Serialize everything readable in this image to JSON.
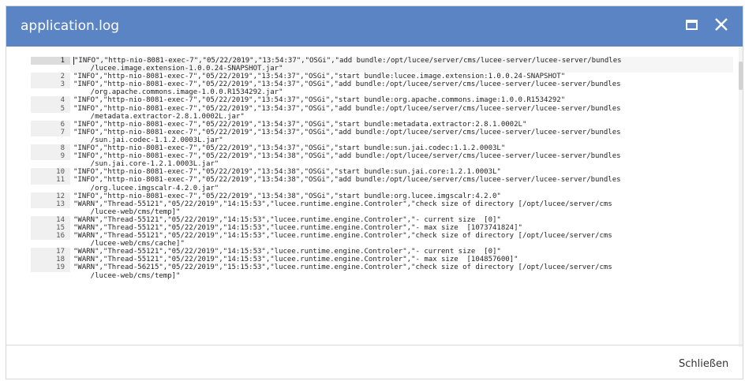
{
  "dialog": {
    "title": "application.log",
    "maximize_icon": "maximize-icon",
    "close_icon": "close-icon",
    "close_button_label": "Schließen",
    "header_color": "#5b84c4"
  },
  "log": {
    "lines": [
      {
        "num": "1",
        "text": "\"INFO\",\"http-nio-8081-exec-7\",\"05/22/2019\",\"13:54:37\",\"OSGi\",\"add bundle:/opt/lucee/server/cms/lucee-server/lucee-server/bundles\n    /lucee.image.extension-1.0.0.24-SNAPSHOT.jar\"",
        "active": true
      },
      {
        "num": "2",
        "text": "\"INFO\",\"http-nio-8081-exec-7\",\"05/22/2019\",\"13:54:37\",\"OSGi\",\"start bundle:lucee.image.extension:1.0.0.24-SNAPSHOT\""
      },
      {
        "num": "3",
        "text": "\"INFO\",\"http-nio-8081-exec-7\",\"05/22/2019\",\"13:54:37\",\"OSGi\",\"add bundle:/opt/lucee/server/cms/lucee-server/lucee-server/bundles\n    /org.apache.commons.image-1.0.0.R1534292.jar\""
      },
      {
        "num": "4",
        "text": "\"INFO\",\"http-nio-8081-exec-7\",\"05/22/2019\",\"13:54:37\",\"OSGi\",\"start bundle:org.apache.commons.image:1.0.0.R1534292\""
      },
      {
        "num": "5",
        "text": "\"INFO\",\"http-nio-8081-exec-7\",\"05/22/2019\",\"13:54:37\",\"OSGi\",\"add bundle:/opt/lucee/server/cms/lucee-server/lucee-server/bundles\n    /metadata.extractor-2.8.1.0002L.jar\""
      },
      {
        "num": "6",
        "text": "\"INFO\",\"http-nio-8081-exec-7\",\"05/22/2019\",\"13:54:37\",\"OSGi\",\"start bundle:metadata.extractor:2.8.1.0002L\""
      },
      {
        "num": "7",
        "text": "\"INFO\",\"http-nio-8081-exec-7\",\"05/22/2019\",\"13:54:37\",\"OSGi\",\"add bundle:/opt/lucee/server/cms/lucee-server/lucee-server/bundles\n    /sun.jai.codec-1.1.2.0003L.jar\""
      },
      {
        "num": "8",
        "text": "\"INFO\",\"http-nio-8081-exec-7\",\"05/22/2019\",\"13:54:37\",\"OSGi\",\"start bundle:sun.jai.codec:1.1.2.0003L\""
      },
      {
        "num": "9",
        "text": "\"INFO\",\"http-nio-8081-exec-7\",\"05/22/2019\",\"13:54:38\",\"OSGi\",\"add bundle:/opt/lucee/server/cms/lucee-server/lucee-server/bundles\n    /sun.jai.core-1.2.1.0003L.jar\""
      },
      {
        "num": "10",
        "text": "\"INFO\",\"http-nio-8081-exec-7\",\"05/22/2019\",\"13:54:38\",\"OSGi\",\"start bundle:sun.jai.core:1.2.1.0003L\""
      },
      {
        "num": "11",
        "text": "\"INFO\",\"http-nio-8081-exec-7\",\"05/22/2019\",\"13:54:38\",\"OSGi\",\"add bundle:/opt/lucee/server/cms/lucee-server/lucee-server/bundles\n    /org.lucee.imgscalr-4.2.0.jar\""
      },
      {
        "num": "12",
        "text": "\"INFO\",\"http-nio-8081-exec-7\",\"05/22/2019\",\"13:54:38\",\"OSGi\",\"start bundle:org.lucee.imgscalr:4.2.0\""
      },
      {
        "num": "13",
        "text": "\"WARN\",\"Thread-55121\",\"05/22/2019\",\"14:15:53\",\"lucee.runtime.engine.Controler\",\"check size of directory [/opt/lucee/server/cms\n    /lucee-web/cms/temp]\""
      },
      {
        "num": "14",
        "text": "\"WARN\",\"Thread-55121\",\"05/22/2019\",\"14:15:53\",\"lucee.runtime.engine.Controler\",\"- current size  [0]\""
      },
      {
        "num": "15",
        "text": "\"WARN\",\"Thread-55121\",\"05/22/2019\",\"14:15:53\",\"lucee.runtime.engine.Controler\",\"- max size  [1073741824]\""
      },
      {
        "num": "16",
        "text": "\"WARN\",\"Thread-55121\",\"05/22/2019\",\"14:15:53\",\"lucee.runtime.engine.Controler\",\"check size of directory [/opt/lucee/server/cms\n    /lucee-web/cms/cache]\""
      },
      {
        "num": "17",
        "text": "\"WARN\",\"Thread-55121\",\"05/22/2019\",\"14:15:53\",\"lucee.runtime.engine.Controler\",\"- current size  [0]\""
      },
      {
        "num": "18",
        "text": "\"WARN\",\"Thread-55121\",\"05/22/2019\",\"14:15:53\",\"lucee.runtime.engine.Controler\",\"- max size  [104857600]\""
      },
      {
        "num": "19",
        "text": "\"WARN\",\"Thread-56215\",\"05/22/2019\",\"15:15:53\",\"lucee.runtime.engine.Controler\",\"check size of directory [/opt/lucee/server/cms\n    /lucee-web/cms/temp]\""
      }
    ]
  }
}
